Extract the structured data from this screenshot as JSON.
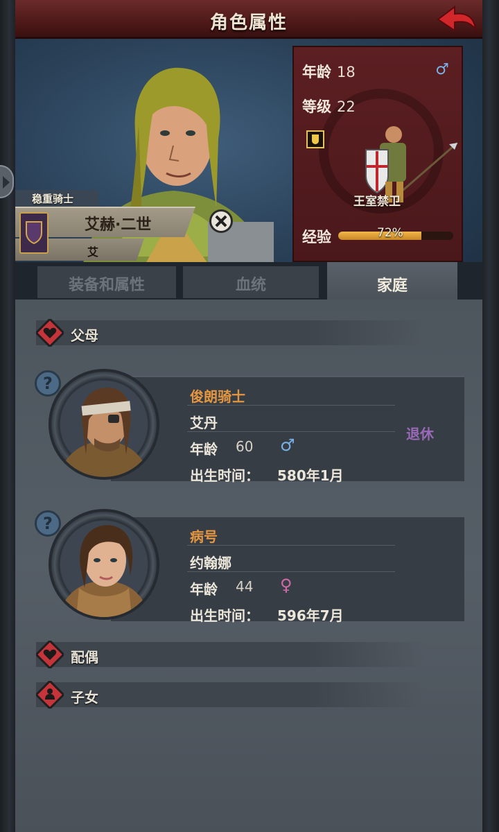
{
  "header": {
    "title": "角色属性"
  },
  "hero": {
    "title_tag": "稳重骑士",
    "name": "艾赫·二世",
    "house_initial": "艾"
  },
  "info": {
    "age_label": "年龄",
    "age": "18",
    "level_label": "等级",
    "level": "22",
    "unit_name": "王室禁卫",
    "exp_label": "经验",
    "exp_percent_text": "72%",
    "exp_fraction": 0.72,
    "gender_icon": "male-icon"
  },
  "tabs": {
    "equip": "装备和属性",
    "bloodline": "血统",
    "family": "家庭"
  },
  "sections": {
    "parents": "父母",
    "spouse": "配偶",
    "children": "子女"
  },
  "parents": [
    {
      "title": "俊朗骑士",
      "name": "艾丹",
      "age_label": "年龄",
      "age": "60",
      "gender_icon": "male-icon",
      "birth_label": "出生时间：",
      "birth": "580年1月",
      "status": "退休"
    },
    {
      "title": "病号",
      "name": "约翰娜",
      "age_label": "年龄",
      "age": "44",
      "gender_icon": "female-icon",
      "birth_label": "出生时间：",
      "birth": "596年7月",
      "status": ""
    }
  ],
  "colors": {
    "header_red": "#5a1f20",
    "title_orange": "#e59640",
    "status_purple": "#9a6ab8",
    "male_blue": "#7ab0e8",
    "female_pink": "#d06aa8",
    "exp_gold": "#f2b84a"
  }
}
